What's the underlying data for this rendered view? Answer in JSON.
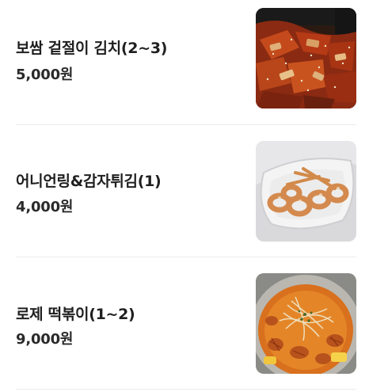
{
  "menu": {
    "items": [
      {
        "name": "보쌈 겉절이 김치(2~3)",
        "price": "5,000원",
        "image_icon": "kimchi-photo"
      },
      {
        "name": "어니언링&감자튀김(1)",
        "price": "4,000원",
        "image_icon": "onion-rings-fries-photo"
      },
      {
        "name": "로제 떡볶이(1~2)",
        "price": "9,000원",
        "image_icon": "rose-tteokbokki-photo"
      }
    ]
  }
}
